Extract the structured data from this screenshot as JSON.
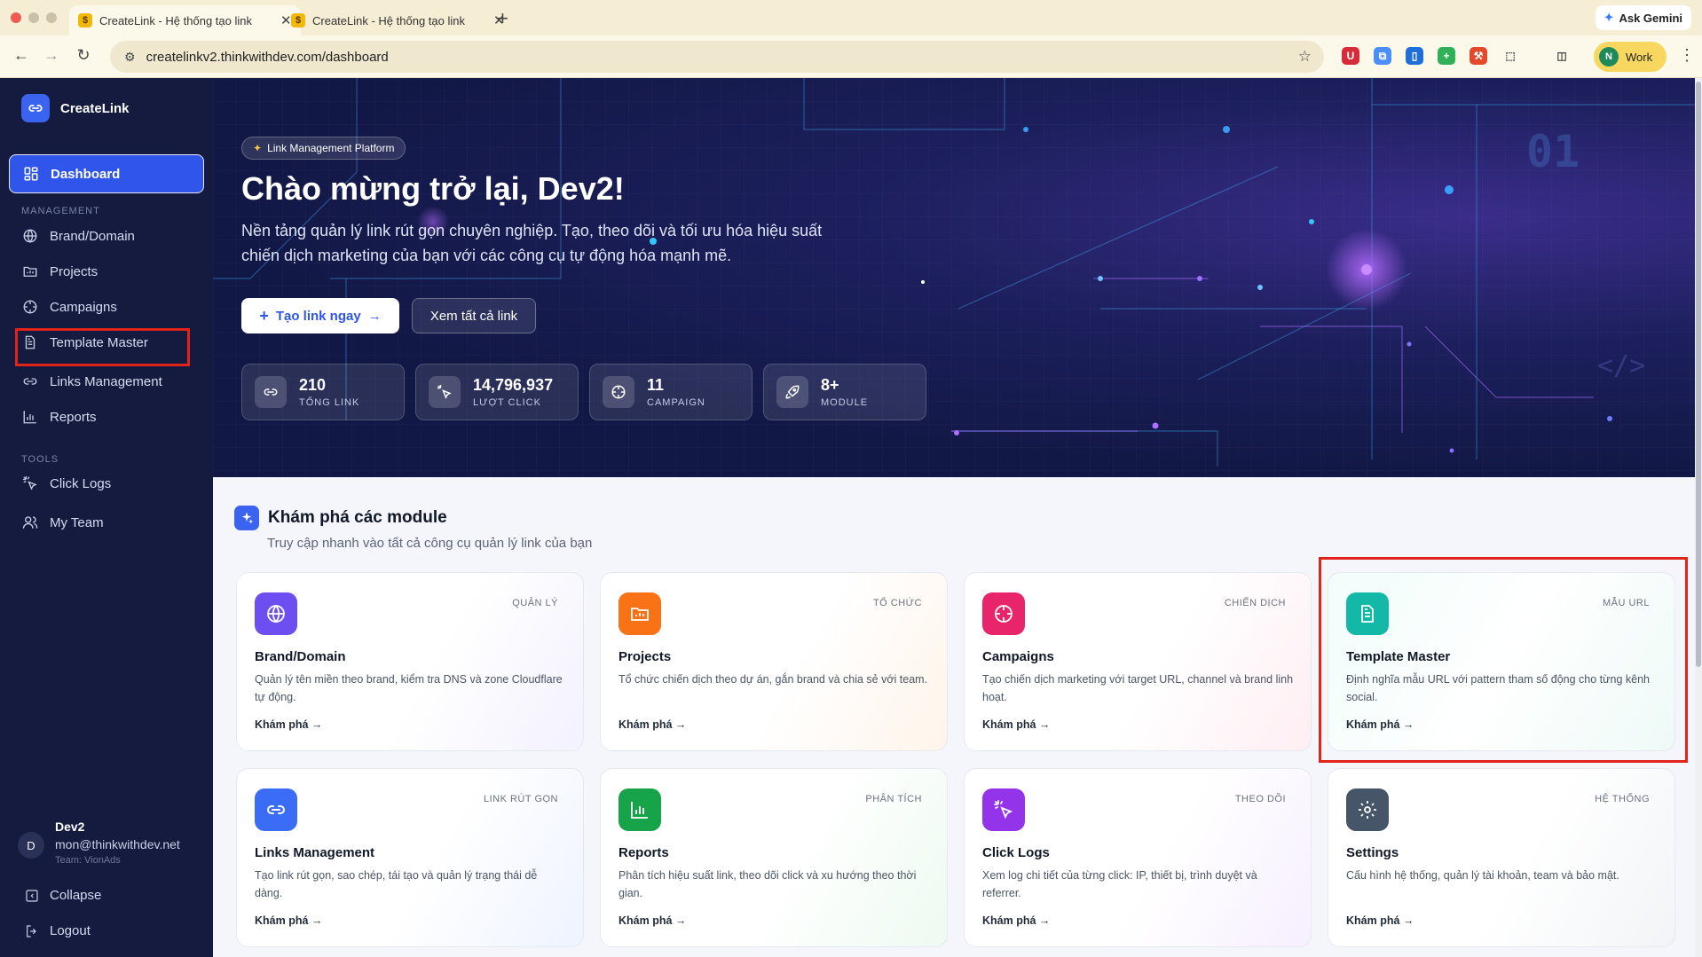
{
  "browser": {
    "tabs": [
      {
        "title": "CreateLink - Hệ thống tạo link"
      },
      {
        "title": "CreateLink - Hệ thống tạo link"
      }
    ],
    "url": "createlinkv2.thinkwithdev.com/dashboard",
    "gemini_label": "Ask Gemini",
    "profile_initial": "N",
    "profile_label": "Work"
  },
  "sidebar": {
    "brand": "CreateLink",
    "dashboard": "Dashboard",
    "management_title": "MANAGEMENT",
    "management_items": [
      {
        "label": "Brand/Domain",
        "icon": "globe-icon"
      },
      {
        "label": "Projects",
        "icon": "folder-icon"
      },
      {
        "label": "Campaigns",
        "icon": "target-icon"
      },
      {
        "label": "Template Master",
        "icon": "document-icon"
      },
      {
        "label": "Links Management",
        "icon": "link-icon"
      },
      {
        "label": "Reports",
        "icon": "bar-chart-icon"
      }
    ],
    "tools_title": "TOOLS",
    "tools_items": [
      {
        "label": "Click Logs",
        "icon": "click-icon"
      },
      {
        "label": "My Team",
        "icon": "users-icon"
      }
    ],
    "user": {
      "initial": "D",
      "name": "Dev2",
      "email": "mon@thinkwithdev.net",
      "team": "Team: VionAds"
    },
    "collapse": "Collapse",
    "logout": "Logout"
  },
  "hero": {
    "badge": "Link Management Platform",
    "title": "Chào mừng trở lại, Dev2!",
    "description": "Nền tảng quản lý link rút gọn chuyên nghiệp. Tạo, theo dõi và tối ưu hóa hiệu suất chiến dịch marketing của bạn với các công cụ tự động hóa mạnh mẽ.",
    "primary_button": "Tạo link ngay",
    "secondary_button": "Xem tất cả link",
    "decor_number": "01",
    "decor_code": "</>",
    "stats": [
      {
        "value": "210",
        "label": "TỔNG LINK",
        "icon": "link-icon"
      },
      {
        "value": "14,796,937",
        "label": "LƯỢT CLICK",
        "icon": "click-icon"
      },
      {
        "value": "11",
        "label": "CAMPAIGN",
        "icon": "target-icon"
      },
      {
        "value": "8+",
        "label": "MODULE",
        "icon": "rocket-icon"
      }
    ]
  },
  "modules": {
    "title": "Khám phá các module",
    "subtitle": "Truy cập nhanh vào tất cả công cụ quản lý link của bạn",
    "cards": [
      {
        "title": "Brand/Domain",
        "tag": "QUẢN LÝ",
        "desc": "Quản lý tên miền theo brand, kiểm tra DNS và zone Cloudflare tự động.",
        "link": "Khám phá",
        "icon": "globe-icon",
        "color": "#6d4ef0"
      },
      {
        "title": "Projects",
        "tag": "TỔ CHỨC",
        "desc": "Tổ chức chiến dịch theo dự án, gắn brand và chia sẻ với team.",
        "link": "Khám phá",
        "icon": "folder-icon",
        "color": "#f97316"
      },
      {
        "title": "Campaigns",
        "tag": "CHIẾN DỊCH",
        "desc": "Tạo chiến dịch marketing với target URL, channel và brand linh hoạt.",
        "link": "Khám phá",
        "icon": "target-icon",
        "color": "#e8246b"
      },
      {
        "title": "Template Master",
        "tag": "MẪU URL",
        "desc": "Định nghĩa mẫu URL với pattern tham số động cho từng kênh social.",
        "link": "Khám phá",
        "icon": "document-icon",
        "color": "#14b8a6"
      },
      {
        "title": "Links Management",
        "tag": "LINK RÚT GỌN",
        "desc": "Tạo link rút gọn, sao chép, tái tạo và quản lý trạng thái dễ dàng.",
        "link": "Khám phá",
        "icon": "link-icon",
        "color": "#3b6cf5"
      },
      {
        "title": "Reports",
        "tag": "PHÂN TÍCH",
        "desc": "Phân tích hiệu suất link, theo dõi click và xu hướng theo thời gian.",
        "link": "Khám phá",
        "icon": "bar-chart-icon",
        "color": "#16a34a"
      },
      {
        "title": "Click Logs",
        "tag": "THEO DÕI",
        "desc": "Xem log chi tiết của từng click: IP, thiết bị, trình duyệt và referrer.",
        "link": "Khám phá",
        "icon": "click-icon",
        "color": "#9333ea"
      },
      {
        "title": "Settings",
        "tag": "HỆ THỐNG",
        "desc": "Cấu hình hệ thống, quản lý tài khoản, team và bảo mật.",
        "link": "Khám phá",
        "icon": "gear-icon",
        "color": "#475569"
      }
    ]
  }
}
